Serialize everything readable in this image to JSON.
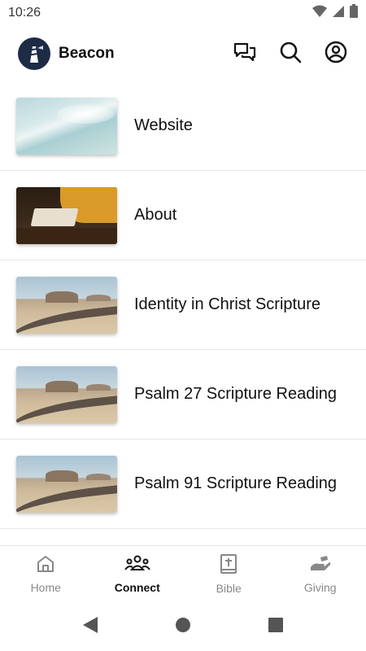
{
  "status_bar": {
    "time": "10:26",
    "icons": [
      "wifi-icon",
      "cell-signal-icon",
      "battery-icon"
    ]
  },
  "app_bar": {
    "title": "Beacon",
    "logo": "lighthouse-logo",
    "actions": [
      "chat-icon",
      "search-icon",
      "account-icon"
    ]
  },
  "list": {
    "items": [
      {
        "label": "Website",
        "thumb": "ocean-waves-image"
      },
      {
        "label": "About",
        "thumb": "open-bible-image"
      },
      {
        "label": "Identity in Christ Scripture",
        "thumb": "desert-road-image"
      },
      {
        "label": "Psalm 27 Scripture Reading",
        "thumb": "desert-road-image"
      },
      {
        "label": "Psalm 91 Scripture Reading",
        "thumb": "desert-road-image"
      }
    ]
  },
  "bottom_nav": {
    "items": [
      {
        "label": "Home",
        "icon": "home-icon",
        "active": false
      },
      {
        "label": "Connect",
        "icon": "people-icon",
        "active": true
      },
      {
        "label": "Bible",
        "icon": "bible-icon",
        "active": false
      },
      {
        "label": "Giving",
        "icon": "giving-hand-icon",
        "active": false
      }
    ]
  },
  "system_nav": [
    "back-icon",
    "home-circle-icon",
    "recents-icon"
  ],
  "colors": {
    "logo_bg": "#1d2b45",
    "active_tab": "#111111",
    "inactive_tab": "#888888",
    "divider": "#e6e6e6"
  }
}
